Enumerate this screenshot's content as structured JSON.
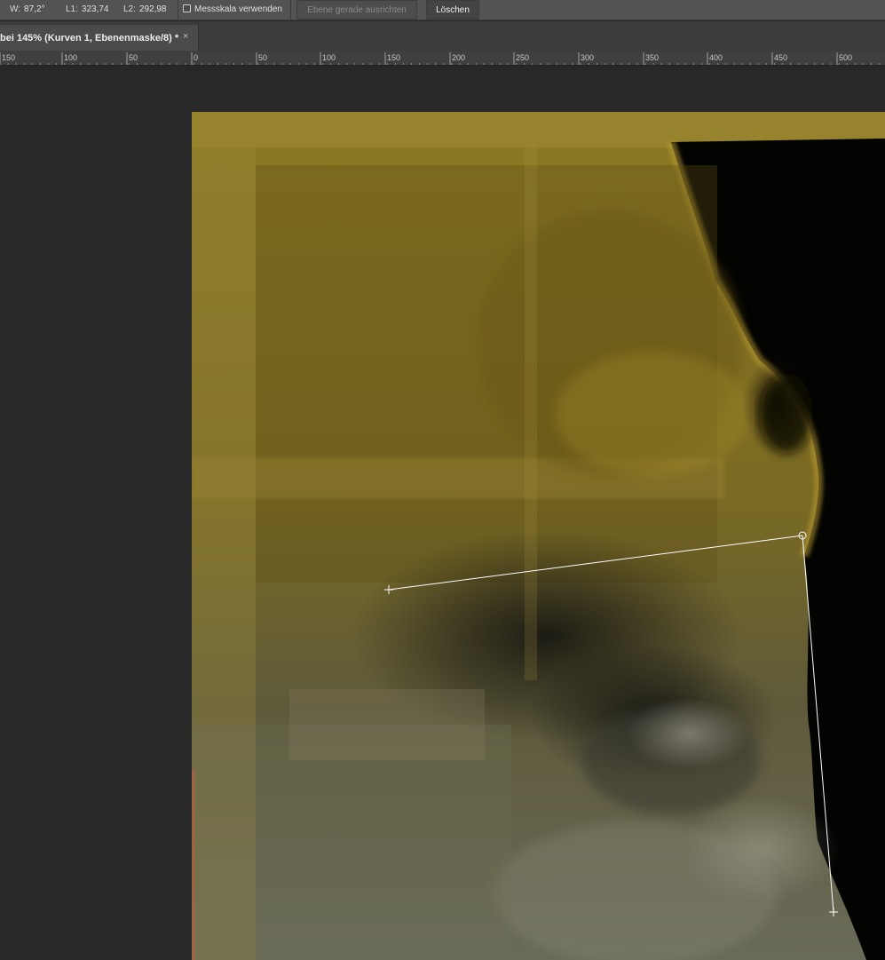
{
  "options_bar": {
    "angle_label": "W:",
    "angle_value": "87,2°",
    "l1_label": "L1:",
    "l1_value": "323,74",
    "l2_label": "L2:",
    "l2_value": "292,98",
    "use_scale_label": "Messskala verwenden",
    "use_scale_checked": false,
    "straighten_label": "Ebene gerade ausrichten",
    "clear_label": "Löschen"
  },
  "document_tab": {
    "title": "bei 145% (Kurven 1, Ebenenmaske/8) *",
    "close_icon": "×"
  },
  "ruler": {
    "labels": [
      "150",
      "100",
      "50",
      "0",
      "50",
      "100",
      "150",
      "200",
      "250",
      "300",
      "350",
      "400",
      "450",
      "500"
    ]
  },
  "canvas": {
    "image_tint": "#8a7a20",
    "background_color": "#000000"
  },
  "measure_tool": {
    "line_color": "#ffffff"
  }
}
